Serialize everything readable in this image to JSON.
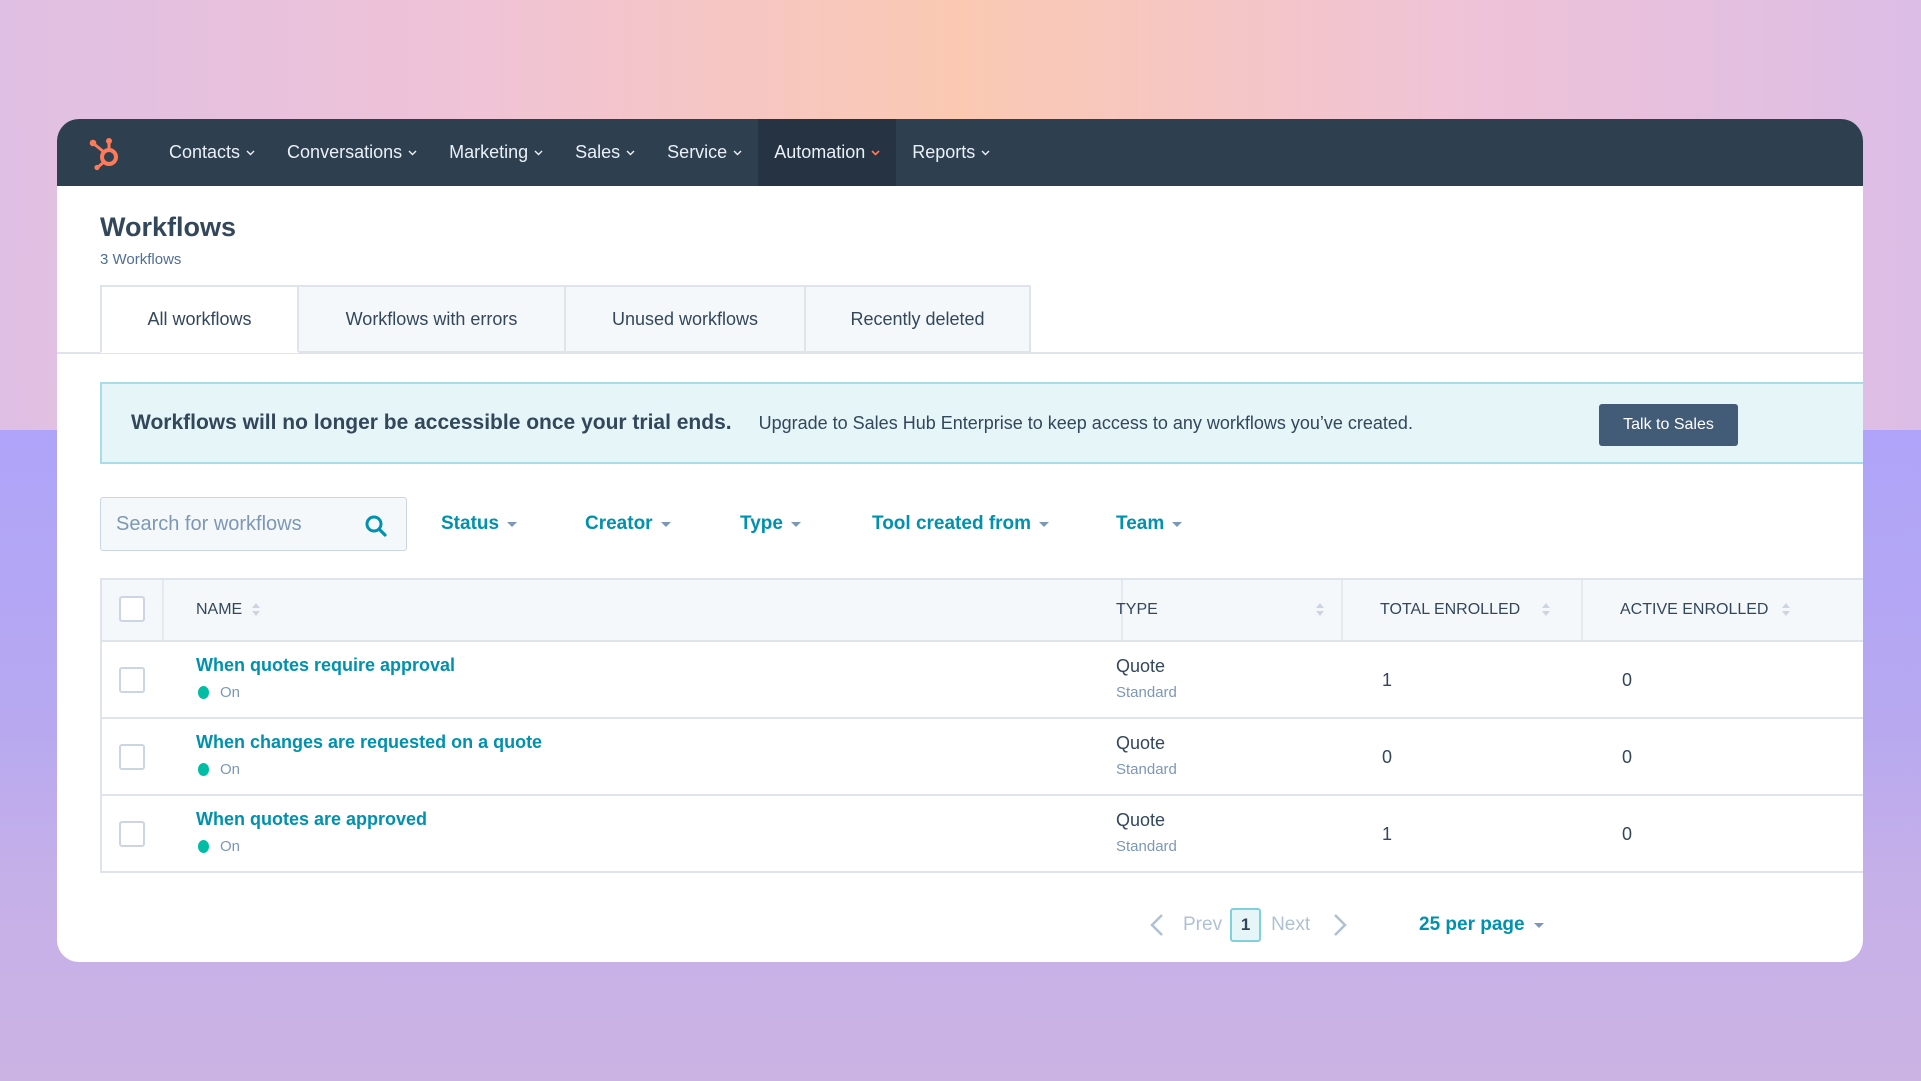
{
  "colors": {
    "nav_bg": "#2e3f50",
    "nav_active_bg": "#253342",
    "brand_orange": "#ff7a59",
    "link": "#0091ae",
    "status_on": "#00bda5",
    "banner_bg": "#e5f5f8",
    "button_bg": "#425b76"
  },
  "nav": {
    "logo": "hubspot-sprocket-icon",
    "items": [
      {
        "label": "Contacts",
        "active": false
      },
      {
        "label": "Conversations",
        "active": false
      },
      {
        "label": "Marketing",
        "active": false
      },
      {
        "label": "Sales",
        "active": false
      },
      {
        "label": "Service",
        "active": false
      },
      {
        "label": "Automation",
        "active": true
      },
      {
        "label": "Reports",
        "active": false
      }
    ]
  },
  "header": {
    "title": "Workflows",
    "subtitle": "3 Workflows"
  },
  "tabs": [
    {
      "label": "All workflows",
      "active": true
    },
    {
      "label": "Workflows with errors",
      "active": false
    },
    {
      "label": "Unused workflows",
      "active": false
    },
    {
      "label": "Recently deleted",
      "active": false
    }
  ],
  "banner": {
    "title": "Workflows will no longer be accessible once your trial ends.",
    "text": "Upgrade to Sales Hub Enterprise to keep access to any workflows you’ve created.",
    "button": "Talk to Sales"
  },
  "filters": {
    "search_placeholder": "Search for workflows",
    "search_value": "",
    "dropdowns": [
      "Status",
      "Creator",
      "Type",
      "Tool created from",
      "Team"
    ]
  },
  "table": {
    "columns": [
      "Name",
      "Type",
      "Total enrolled",
      "Active enrolled"
    ],
    "rows": [
      {
        "name": "When quotes require approval",
        "status": "On",
        "type": "Quote",
        "subtype": "Standard",
        "total_enrolled": "1",
        "active_enrolled": "0"
      },
      {
        "name": "When changes are requested on a quote",
        "status": "On",
        "type": "Quote",
        "subtype": "Standard",
        "total_enrolled": "0",
        "active_enrolled": "0"
      },
      {
        "name": "When quotes are approved",
        "status": "On",
        "type": "Quote",
        "subtype": "Standard",
        "total_enrolled": "1",
        "active_enrolled": "0"
      }
    ]
  },
  "pagination": {
    "prev": "Prev",
    "current_page": "1",
    "next": "Next",
    "per_page": "25 per page"
  }
}
